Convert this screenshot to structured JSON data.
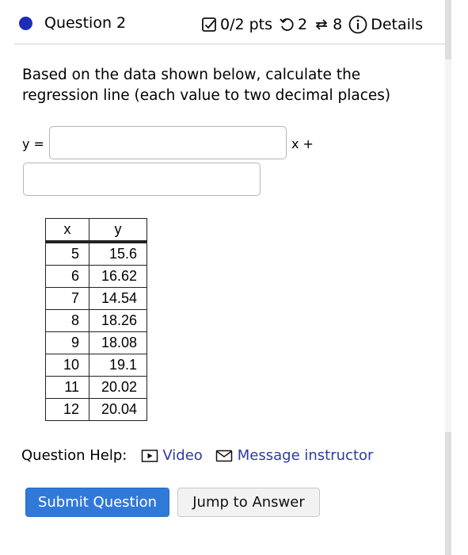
{
  "header": {
    "title": "Question 2",
    "points": "0/2 pts",
    "retries": "2",
    "attempts": "8",
    "details": "Details",
    "dot_color": "#1e2db8"
  },
  "prompt": "Based on the data shown below, calculate the regression line (each value to two decimal places)",
  "equation": {
    "y_label": "y =",
    "x_label": "x +",
    "slope_value": "",
    "intercept_value": ""
  },
  "table": {
    "headers": [
      "x",
      "y"
    ],
    "rows": [
      [
        "5",
        "15.6"
      ],
      [
        "6",
        "16.62"
      ],
      [
        "7",
        "14.54"
      ],
      [
        "8",
        "18.26"
      ],
      [
        "9",
        "18.08"
      ],
      [
        "10",
        "19.1"
      ],
      [
        "11",
        "20.02"
      ],
      [
        "12",
        "20.04"
      ]
    ]
  },
  "help": {
    "label": "Question Help:",
    "video": "Video",
    "message": "Message instructor"
  },
  "buttons": {
    "submit": "Submit Question",
    "jump": "Jump to Answer"
  },
  "colors": {
    "link": "#2c3b9e",
    "submit_bg": "#3179d8"
  }
}
